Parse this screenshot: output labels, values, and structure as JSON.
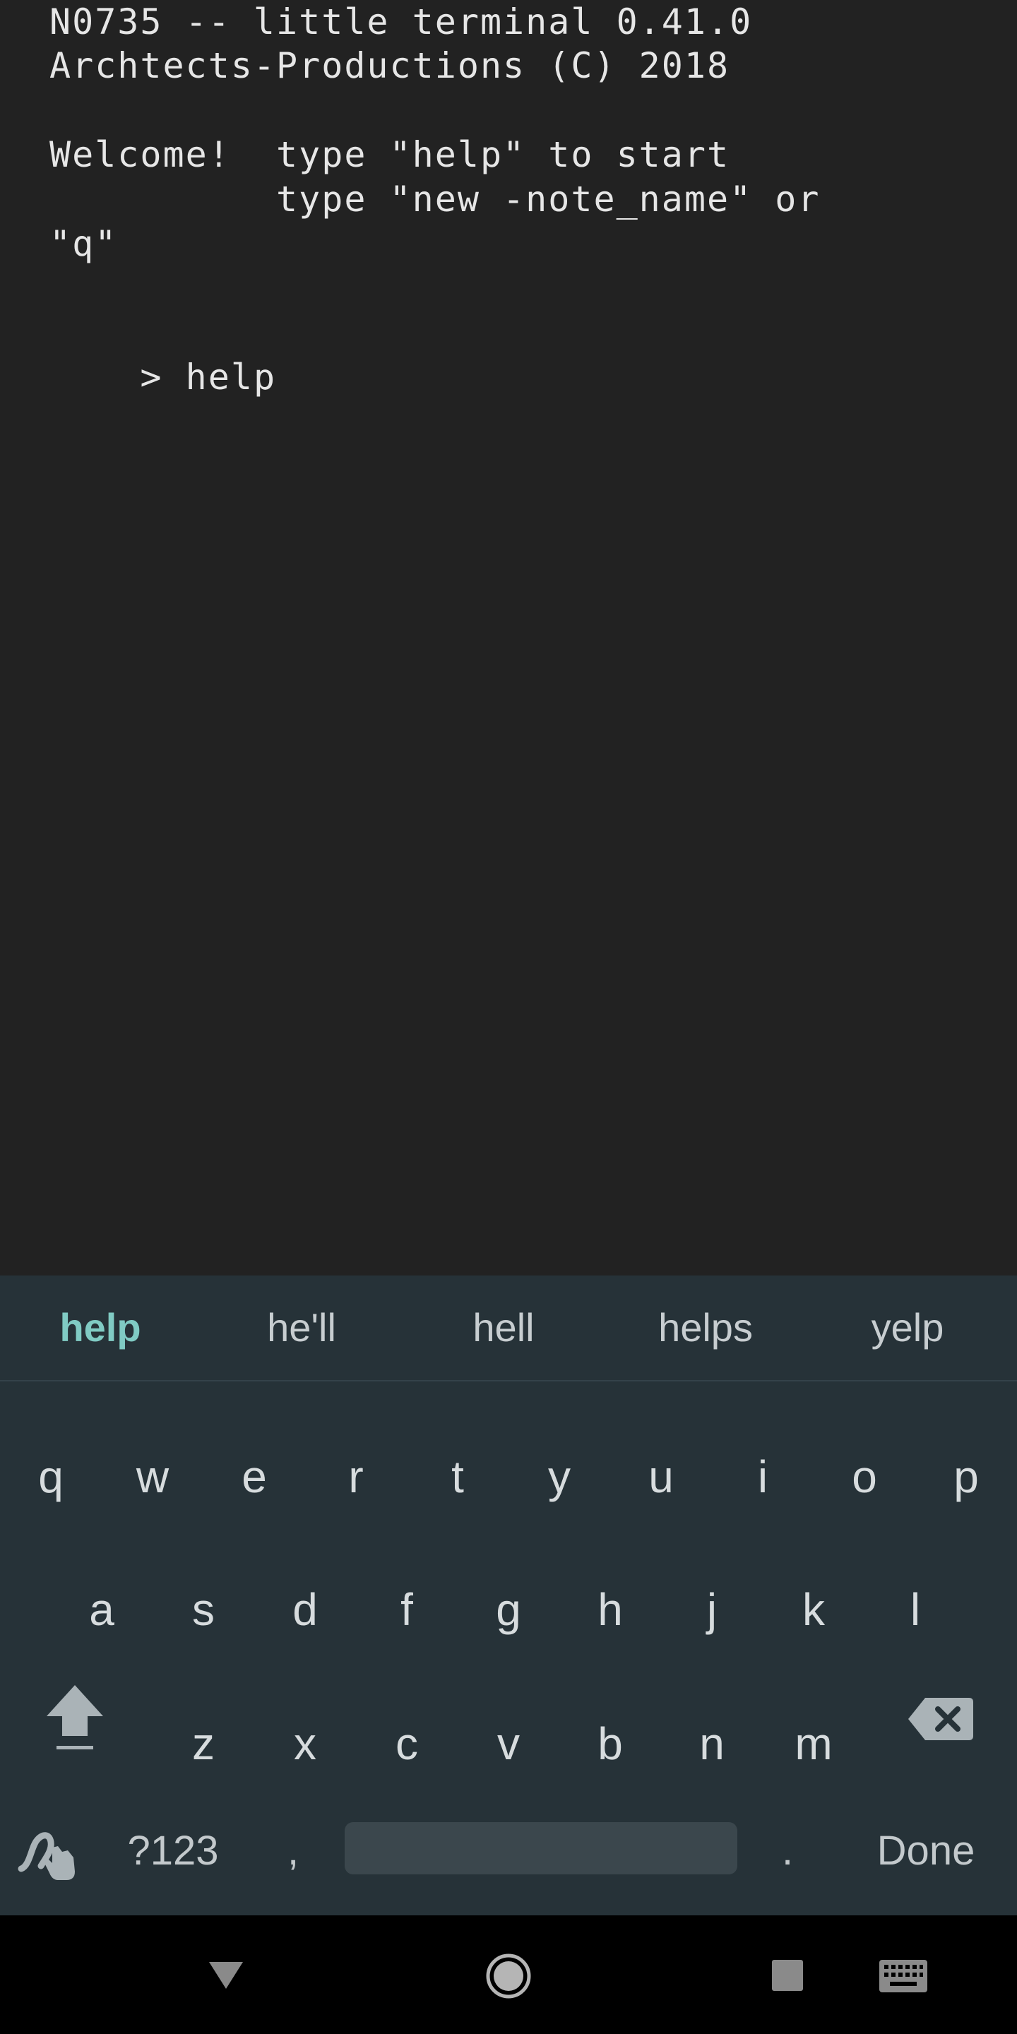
{
  "terminal": {
    "line1": "N0735 -- little terminal 0.41.0",
    "line2": "Archtects-Productions (C) 2018",
    "line3": "Welcome!  type \"help\" to start",
    "line4": "          type \"new -note_name\" or",
    "line5": "\"q\"",
    "prompt": ">",
    "command": "help"
  },
  "keyboard": {
    "suggestions": [
      "help",
      "he'll",
      "hell",
      "helps",
      "yelp"
    ],
    "row1": [
      "q",
      "w",
      "e",
      "r",
      "t",
      "y",
      "u",
      "i",
      "o",
      "p"
    ],
    "row2": [
      "a",
      "s",
      "d",
      "f",
      "g",
      "h",
      "j",
      "k",
      "l"
    ],
    "row3": [
      "z",
      "x",
      "c",
      "v",
      "b",
      "n",
      "m"
    ],
    "symbols_label": "?123",
    "comma_label": ",",
    "period_label": ".",
    "done_label": "Done",
    "shift_icon": "shift-icon",
    "backspace_icon": "backspace-icon",
    "handwriting_icon": "handwriting-icon"
  },
  "navbar": {
    "back_icon": "back-triangle-icon",
    "home_icon": "home-circle-icon",
    "recents_icon": "recents-square-icon",
    "keyboard_icon": "keyboard-switch-icon"
  },
  "colors": {
    "terminal_bg": "#222222",
    "terminal_text": "#e6e6e6",
    "keyboard_bg": "#263238",
    "suggestion_primary": "#80cbc4"
  }
}
